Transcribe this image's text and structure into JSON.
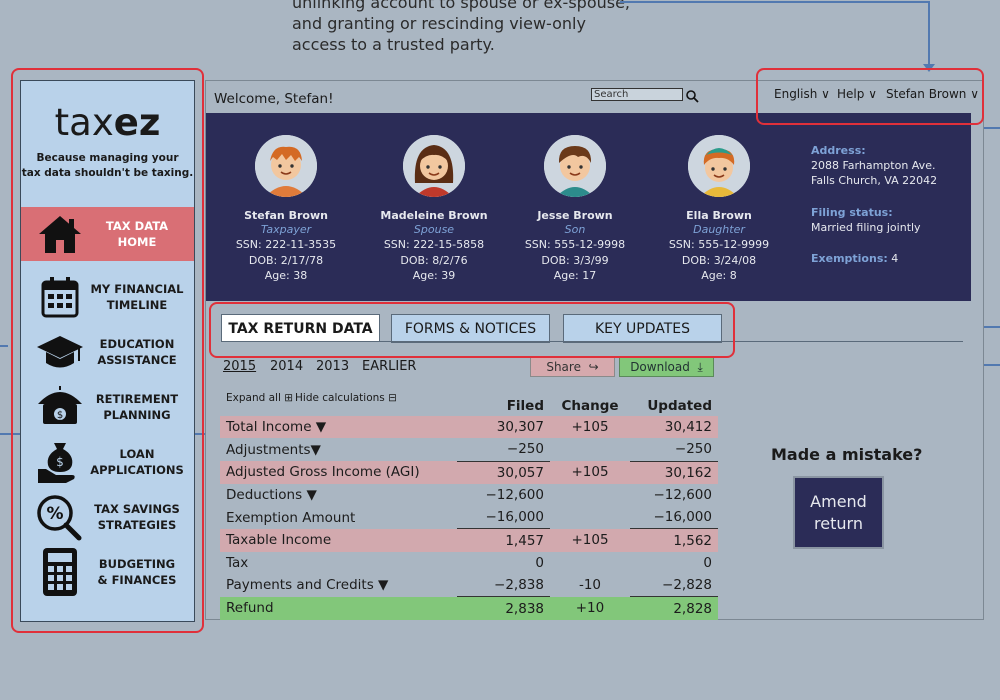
{
  "annotation": {
    "text": "unlinking account to spouse or ex-spouse, and granting or rescinding view-only access to a trusted party."
  },
  "brand": {
    "logo_light": "tax",
    "logo_bold": "ez",
    "tagline_line1": "Because managing your",
    "tagline_line2": "tax data shouldn't be taxing."
  },
  "sidebar": {
    "items": [
      {
        "line1": "TAX DATA",
        "line2": "HOME",
        "icon": "home-icon",
        "active": true
      },
      {
        "line1": "MY FINANCIAL",
        "line2": "TIMELINE",
        "icon": "calendar-icon"
      },
      {
        "line1": "EDUCATION",
        "line2": "ASSISTANCE",
        "icon": "graduation-cap-icon"
      },
      {
        "line1": "RETIREMENT",
        "line2": "PLANNING",
        "icon": "umbrella-money-icon"
      },
      {
        "line1": "LOAN",
        "line2": "APPLICATIONS",
        "icon": "money-bag-hand-icon"
      },
      {
        "line1": "TAX SAVINGS",
        "line2": "STRATEGIES",
        "icon": "percent-magnifier-icon"
      },
      {
        "line1": "BUDGETING",
        "line2": "& FINANCES",
        "icon": "calculator-icon"
      }
    ]
  },
  "header": {
    "welcome": "Welcome, Stefan!",
    "search_placeholder": "Search",
    "language": "English",
    "help": "Help",
    "user": "Stefan Brown"
  },
  "family": {
    "members": [
      {
        "name": "Stefan Brown",
        "role": "Taxpayer",
        "ssn": "SSN: 222-11-3535",
        "dob": "DOB: 2/17/78",
        "age": "Age: 38"
      },
      {
        "name": "Madeleine Brown",
        "role": "Spouse",
        "ssn": "SSN: 222-15-5858",
        "dob": "DOB: 8/2/76",
        "age": "Age: 39"
      },
      {
        "name": "Jesse Brown",
        "role": "Son",
        "ssn": "SSN: 555-12-9998",
        "dob": "DOB: 3/3/99",
        "age": "Age: 17"
      },
      {
        "name": "Ella Brown",
        "role": "Daughter",
        "ssn": "SSN: 555-12-9999",
        "dob": "DOB: 3/24/08",
        "age": "Age: 8"
      }
    ],
    "address_label": "Address:",
    "address_line1": "2088 Farhampton Ave.",
    "address_line2": "Falls Church, VA 22042",
    "filing_label": "Filing status:",
    "filing_value": "Married filing jointly",
    "exemptions_label": "Exemptions:",
    "exemptions_value": "4"
  },
  "tabs": [
    {
      "label": "TAX RETURN DATA",
      "active": true
    },
    {
      "label": "FORMS & NOTICES"
    },
    {
      "label": "KEY UPDATES"
    }
  ],
  "years": [
    "2015",
    "2014",
    "2013",
    "EARLIER"
  ],
  "actions": {
    "share": "Share",
    "download": "Download",
    "expand_all": "Expand all",
    "hide_calculations": "Hide calculations"
  },
  "table": {
    "headers": [
      "Filed",
      "Change",
      "Updated"
    ],
    "rows": [
      {
        "label": "Total Income",
        "filed": "30,307",
        "change": "+105",
        "updated": "30,412",
        "style": "pink",
        "caret": true
      },
      {
        "label": "Adjustments",
        "filed": "−250",
        "change": "",
        "updated": "−250",
        "style": "",
        "caret": true,
        "underline": true
      },
      {
        "label": "Adjusted Gross Income (AGI)",
        "filed": "30,057",
        "change": "+105",
        "updated": "30,162",
        "style": "pink"
      },
      {
        "label": "Deductions",
        "filed": "−12,600",
        "change": "",
        "updated": "−12,600",
        "style": "",
        "caret": true
      },
      {
        "label": "Exemption Amount",
        "filed": "−16,000",
        "change": "",
        "updated": "−16,000",
        "style": "",
        "underline": true
      },
      {
        "label": "Taxable Income",
        "filed": "1,457",
        "change": "+105",
        "updated": "1,562",
        "style": "pink"
      },
      {
        "label": "Tax",
        "filed": "0",
        "change": "",
        "updated": "0",
        "style": ""
      },
      {
        "label": "Payments and Credits",
        "filed": "−2,838",
        "change": "-10",
        "updated": "−2,828",
        "style": "",
        "caret": true,
        "underline": true
      },
      {
        "label": "Refund",
        "filed": "2,838",
        "change": "+10",
        "updated": "2,828",
        "style": "green"
      }
    ]
  },
  "mistake": {
    "title": "Made a mistake?",
    "button_line1": "Amend",
    "button_line2": "return"
  },
  "colors": {
    "banner": "#2b2c57",
    "sidebar": "#b9d2ea",
    "active_nav": "#d96f75",
    "highlight_row": "#d2a9ae",
    "refund_row": "#82c77a",
    "annotation_box": "#e0303a",
    "annotation_line": "#5279b0"
  }
}
